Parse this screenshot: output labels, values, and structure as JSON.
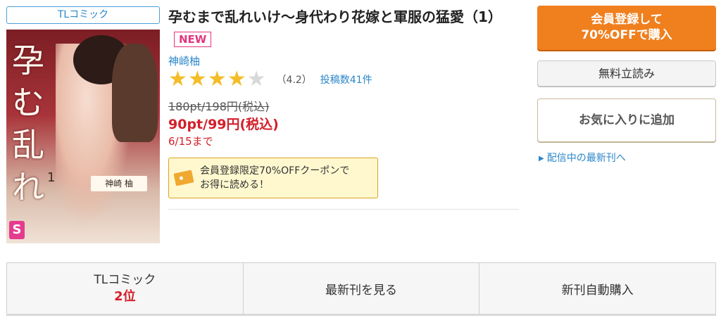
{
  "category_tag": "TLコミック",
  "cover": {
    "title_chars": "孕む乱れ",
    "author_band": "神崎 柚",
    "volume": "1",
    "logo": "S"
  },
  "book": {
    "title": "孕むまで乱れいけ〜身代わり花嫁と軍服の猛愛（1）",
    "new_badge": "NEW",
    "author": "神崎柚",
    "rating": 4.2,
    "rating_label": "（4.2）",
    "review_count_label": "投稿数41件",
    "original_price": "180pt/198円(税込)",
    "sale_price": "90pt/99円(税込)",
    "sale_until": "6/15まで"
  },
  "coupon": {
    "text_line1": "会員登録限定70%OFFクーポンで",
    "text_line2": "お得に読める！",
    "icon": "coupon-ticket-icon"
  },
  "actions": {
    "register_line1": "会員登録して",
    "register_line2": "70%OFFで購入",
    "free_trial": "無料立読み",
    "add_favorite": "お気に入りに追加",
    "latest_link": "配信中の最新刊へ"
  },
  "bottom_bar": {
    "ranking_category": "TLコミック",
    "ranking_value": "2位",
    "view_latest": "最新刊を見る",
    "auto_purchase": "新刊自動購入"
  },
  "colors": {
    "accent_orange": "#f07f1e",
    "link_blue": "#2a86c9",
    "price_red": "#d31f2a",
    "star_gold": "#f4bd28",
    "new_pink": "#e6347f"
  }
}
